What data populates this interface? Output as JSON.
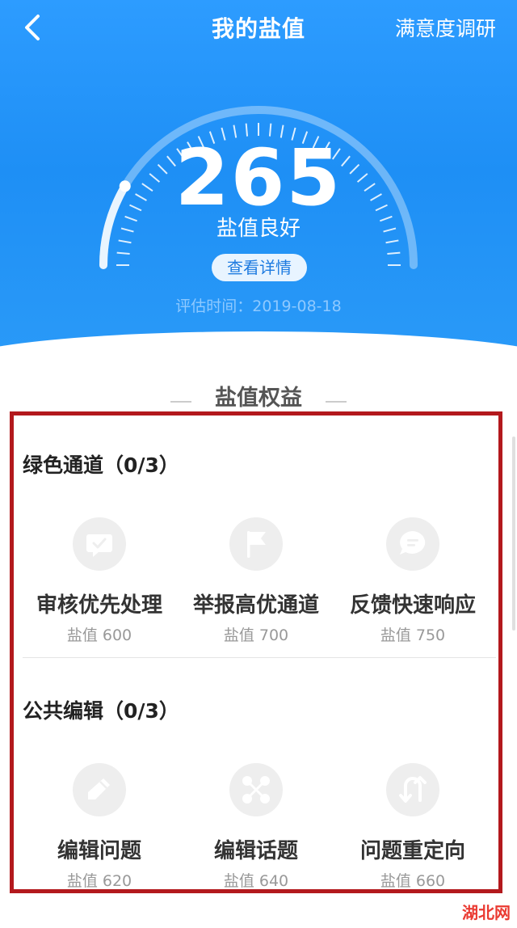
{
  "header": {
    "title": "我的盐值",
    "survey_label": "满意度调研"
  },
  "score_panel": {
    "score": "265",
    "grade": "盐值良好",
    "detail_button": "查看详情",
    "eval_time": "评估时间：2019-08-18"
  },
  "rights": {
    "section_title": "盐值权益",
    "groups": [
      {
        "title": "绿色通道（0/3）",
        "items": [
          {
            "name": "审核优先处理",
            "value": "盐值 600",
            "icon": "check-message-icon"
          },
          {
            "name": "举报高优通道",
            "value": "盐值 700",
            "icon": "flag-icon"
          },
          {
            "name": "反馈快速响应",
            "value": "盐值 750",
            "icon": "chat-bubble-icon"
          }
        ]
      },
      {
        "title": "公共编辑（0/3）",
        "items": [
          {
            "name": "编辑问题",
            "value": "盐值 620",
            "icon": "pencil-icon"
          },
          {
            "name": "编辑话题",
            "value": "盐值 640",
            "icon": "topic-network-icon"
          },
          {
            "name": "问题重定向",
            "value": "盐值 660",
            "icon": "redirect-arrows-icon"
          }
        ]
      }
    ]
  },
  "watermark": "湖北网",
  "colors": {
    "brand_blue": "#1e8ff5",
    "highlight_border": "#b3191d",
    "icon_bg": "#eeeeee"
  }
}
